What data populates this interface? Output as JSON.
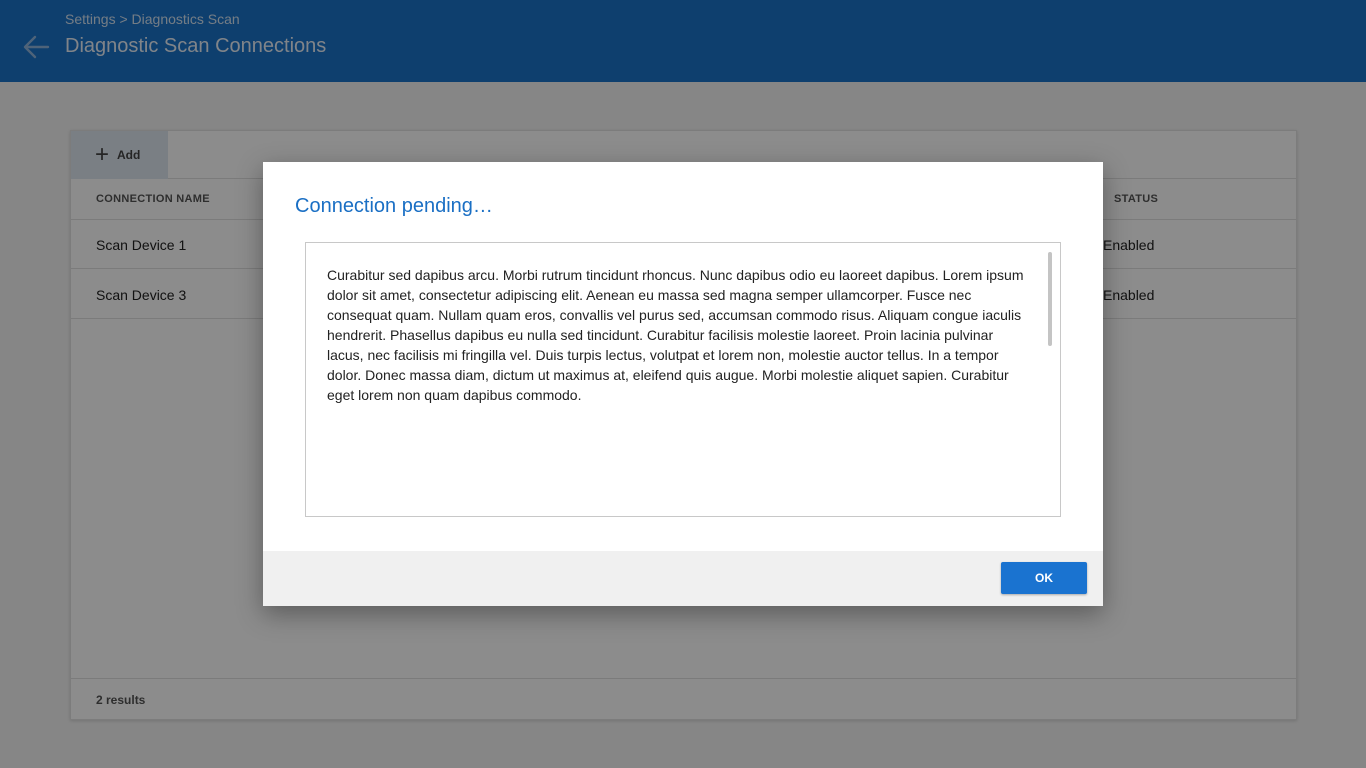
{
  "header": {
    "breadcrumb": "Settings > Diagnostics Scan",
    "title": "Diagnostic Scan Connections",
    "back_icon": "arrow-left-icon",
    "background": "#1a73c9"
  },
  "toolbar": {
    "add_label": "Add",
    "add_icon": "plus-icon"
  },
  "table": {
    "columns": [
      "CONNECTION NAME",
      "STATUS"
    ],
    "rows": [
      {
        "name": "Scan Device 1",
        "status": "Enabled"
      },
      {
        "name": "Scan Device 3",
        "status": "Enabled"
      }
    ],
    "results": "2 results"
  },
  "dialog": {
    "title": "Connection pending…",
    "body": "Curabitur sed dapibus arcu. Morbi rutrum tincidunt rhoncus. Nunc dapibus odio eu laoreet dapibus. Lorem ipsum dolor sit amet, consectetur adipiscing elit. Aenean eu massa sed magna semper ullamcorper. Fusce nec consequat quam. Nullam quam eros, convallis vel purus sed, accumsan commodo risus. Aliquam congue iaculis hendrerit. Phasellus dapibus eu nulla sed tincidunt. Curabitur facilisis molestie laoreet. Proin lacinia pulvinar lacus, nec facilisis mi fringilla vel. Duis turpis lectus, volutpat et lorem non, molestie auctor tellus. In a tempor dolor. Donec massa diam, dictum ut maximus at, eleifend quis augue. Morbi molestie aliquet sapien. Curabitur eget lorem non quam dapibus commodo.",
    "ok_label": "OK",
    "accent": "#1a73d0"
  }
}
